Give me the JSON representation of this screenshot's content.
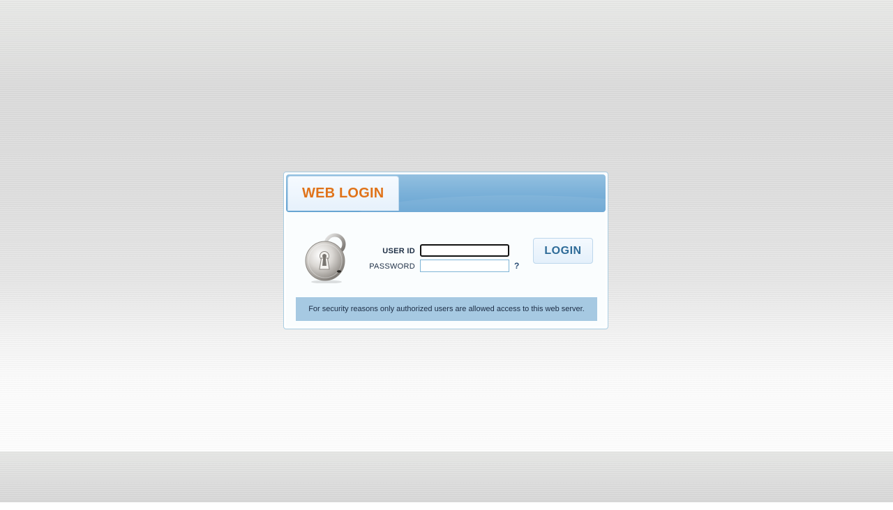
{
  "panel": {
    "title": "WEB LOGIN"
  },
  "form": {
    "user_id_label": "USER ID",
    "password_label": "PASSWORD",
    "user_id_value": "",
    "password_value": "",
    "help_label": "?",
    "login_label": "LOGIN"
  },
  "notice": {
    "text": "For security reasons only authorized users are allowed access to this web server."
  },
  "icons": {
    "lock": "lock-icon"
  },
  "colors": {
    "title": "#e07319",
    "header_blue": "#7db2d9",
    "notice_bg": "#a6c9e2",
    "button_text": "#2e6b98"
  }
}
